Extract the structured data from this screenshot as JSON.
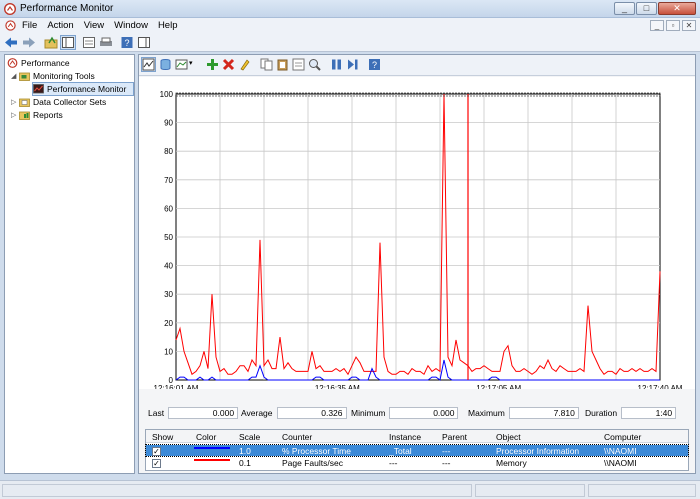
{
  "window": {
    "title": "Performance Monitor"
  },
  "menu": {
    "items": [
      "File",
      "Action",
      "View",
      "Window",
      "Help"
    ]
  },
  "tree": {
    "items": [
      {
        "label": "Performance",
        "icon": "performance-icon",
        "expanded": true
      },
      {
        "label": "Monitoring Tools",
        "icon": "monitoring-tools-folder-icon",
        "expanded": true
      },
      {
        "label": "Performance Monitor",
        "icon": "performance-monitor-icon",
        "selected": true
      },
      {
        "label": "Data Collector Sets",
        "icon": "data-collector-sets-icon",
        "expanded": false
      },
      {
        "label": "Reports",
        "icon": "reports-icon",
        "expanded": false
      }
    ]
  },
  "chart_data": {
    "type": "line",
    "ylim": [
      0,
      100
    ],
    "yticks": [
      "0",
      "10",
      "20",
      "30",
      "40",
      "50",
      "60",
      "70",
      "80",
      "90",
      "100"
    ],
    "xticks": [
      "12:16:01 AM",
      "12:16:35 AM",
      "12:17:05 AM",
      "12:17:40 AM"
    ],
    "grid": true,
    "series": [
      {
        "color": "#ff0000",
        "values": [
          14,
          18,
          10,
          6,
          2,
          3,
          5,
          10,
          4,
          30,
          8,
          3,
          4,
          2,
          2,
          3,
          5,
          5,
          3,
          7,
          5,
          49,
          5,
          7,
          4,
          4,
          15,
          4,
          6,
          4,
          3,
          3,
          3,
          3,
          10,
          4,
          5,
          3,
          3,
          3,
          4,
          3,
          4,
          2,
          5,
          8,
          6,
          3,
          3,
          3,
          3,
          48,
          8,
          3,
          2,
          2,
          3,
          3,
          2,
          4,
          3,
          3,
          2,
          5,
          3,
          4,
          3,
          102,
          8,
          5,
          14,
          7,
          6,
          5,
          3,
          4,
          4,
          5,
          4,
          3,
          3,
          3,
          10,
          12,
          5,
          3,
          3,
          4,
          3,
          2,
          3,
          5,
          4,
          7,
          4,
          3,
          5,
          4,
          3,
          3,
          3,
          4,
          3,
          26,
          10,
          7,
          4,
          2,
          3,
          3,
          2,
          4,
          3,
          3,
          4,
          3,
          4,
          3,
          3,
          4,
          3,
          38
        ]
      },
      {
        "color": "#0000ff",
        "values": [
          0,
          1,
          1,
          0,
          0,
          0,
          1,
          0,
          0,
          1,
          0,
          0,
          0,
          0,
          0,
          0,
          0,
          0,
          0,
          1,
          1,
          5,
          1,
          0,
          0,
          0,
          0,
          0,
          0,
          0,
          0,
          0,
          0,
          0,
          0,
          1,
          1,
          0,
          0,
          0,
          0,
          0,
          0,
          0,
          1,
          1,
          0,
          0,
          0,
          4,
          1,
          0,
          0,
          0,
          0,
          0,
          0,
          0,
          0,
          0,
          0,
          0,
          0,
          0,
          1,
          1,
          0,
          7,
          1,
          0,
          0,
          0,
          0,
          0,
          0,
          0,
          0,
          0,
          0,
          1,
          1,
          0,
          0,
          0,
          0,
          0,
          0,
          0,
          0,
          0,
          0,
          0,
          0,
          0,
          0,
          0,
          0,
          0,
          0,
          0,
          0,
          0,
          0,
          0,
          0,
          0,
          0,
          0,
          0,
          0,
          0,
          0,
          0,
          0,
          0,
          0,
          0,
          0,
          0,
          0,
          0,
          0
        ]
      }
    ]
  },
  "stats": {
    "last_label": "Last",
    "last_value": "0.000",
    "average_label": "Average",
    "average_value": "0.326",
    "minimum_label": "Minimum",
    "minimum_value": "0.000",
    "maximum_label": "Maximum",
    "maximum_value": "7.810",
    "duration_label": "Duration",
    "duration_value": "1:40"
  },
  "legend": {
    "headers": [
      "Show",
      "Color",
      "Scale",
      "Counter",
      "Instance",
      "Parent",
      "Object",
      "Computer"
    ],
    "rows": [
      {
        "scale": "1.0",
        "counter": "% Processor Time",
        "instance": "_Total",
        "parent": "---",
        "object": "Processor Information",
        "computer": "\\\\NAOMI",
        "color": "#0000ff",
        "selected": true
      },
      {
        "scale": "0.1",
        "counter": "Page Faults/sec",
        "instance": "---",
        "parent": "---",
        "object": "Memory",
        "computer": "\\\\NAOMI",
        "color": "#ff0000",
        "selected": false
      }
    ]
  }
}
